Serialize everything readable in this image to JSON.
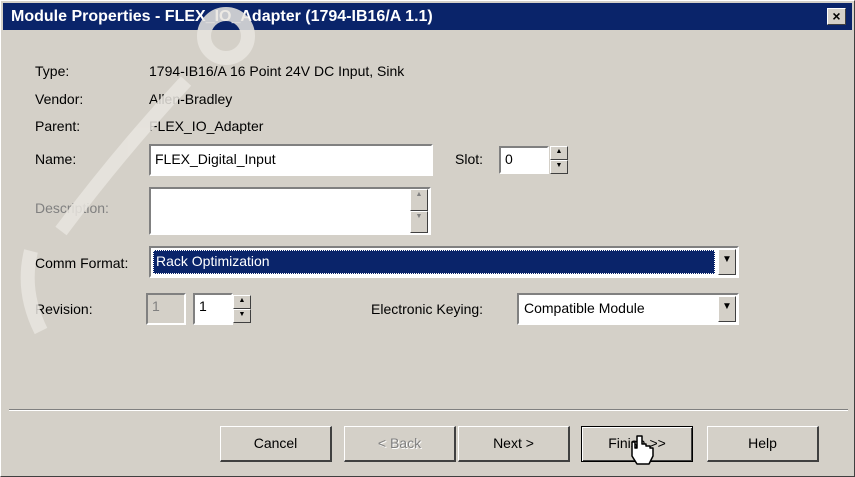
{
  "window": {
    "title": "Module Properties - FLEX_IO_Adapter (1794-IB16/A 1.1)",
    "close_glyph": "×"
  },
  "info": {
    "type_label": "Type:",
    "type_value": "1794-IB16/A 16 Point 24V DC Input, Sink",
    "vendor_label": "Vendor:",
    "vendor_value": "Allen-Bradley",
    "parent_label": "Parent:",
    "parent_value": "FLEX_IO_Adapter"
  },
  "name": {
    "label": "Name:",
    "value": "FLEX_Digital_Input"
  },
  "slot": {
    "label": "Slot:",
    "value": "0"
  },
  "description": {
    "label": "Description:",
    "value": ""
  },
  "comm_format": {
    "label": "Comm Format:",
    "selected": "Rack Optimization"
  },
  "revision": {
    "label": "Revision:",
    "major": "1",
    "minor": "1"
  },
  "electronic_keying": {
    "label": "Electronic Keying:",
    "selected": "Compatible Module"
  },
  "buttons": {
    "cancel": "Cancel",
    "back": "< Back",
    "next": "Next >",
    "finish": "Finish >>",
    "help": "Help"
  },
  "icons": {
    "spin_up": "arrow-up-icon",
    "spin_down": "arrow-down-icon",
    "dropdown": "chevron-down-icon",
    "cursor": "mouse-pointer-icon",
    "watermark": "watermark-logo"
  },
  "colors": {
    "titlebar": "#0a246a",
    "dialog_face": "#d4d0c8",
    "selection": "#0a246a"
  }
}
